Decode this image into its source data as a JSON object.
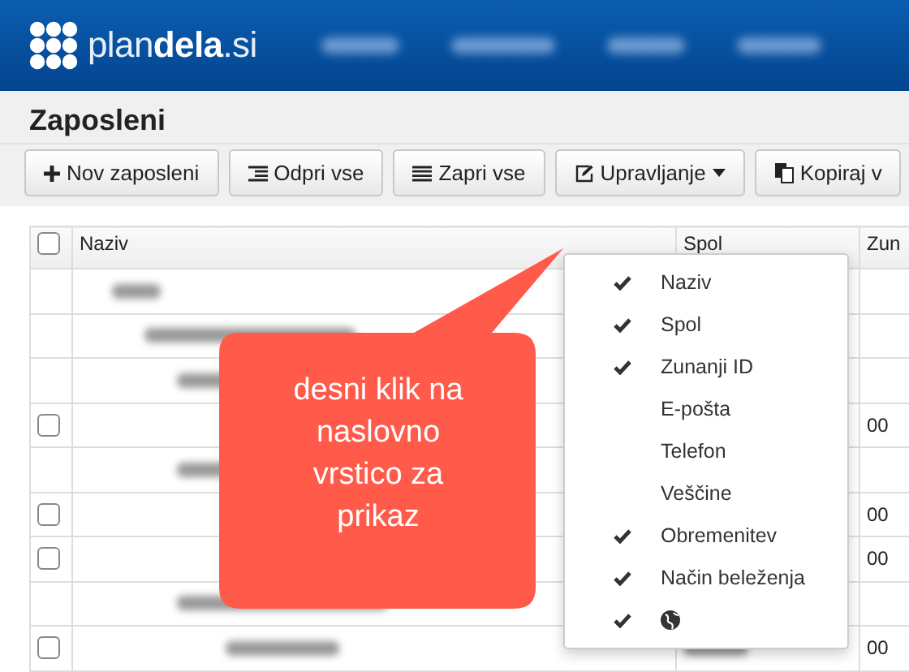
{
  "header": {
    "logo": "plan**dela**.si"
  },
  "page_title": "Zaposleni",
  "toolbar": [
    {
      "label": "Nov zaposleni"
    },
    {
      "label": "Odpri vse"
    },
    {
      "label": "Zapri vse"
    },
    {
      "label": "Upravljanje"
    },
    {
      "label": "Kopiraj v"
    }
  ],
  "table": {
    "select_all": {
      "checked": false
    },
    "columns": [
      "Naziv",
      "Spol",
      "Zun"
    ],
    "rows": [
      {
        "kind": "group"
      },
      {
        "kind": "group"
      },
      {
        "kind": "group"
      },
      {
        "kind": "item",
        "checked": false,
        "column_3": "00"
      },
      {
        "kind": "group"
      },
      {
        "kind": "item",
        "checked": false,
        "column_3": "00"
      },
      {
        "kind": "item",
        "checked": false,
        "column_3": "00"
      },
      {
        "kind": "group"
      },
      {
        "kind": "item",
        "checked": false,
        "column_3": "00"
      }
    ]
  },
  "callout": "desni klik na naslovno vrstico za prikaz",
  "column_menu": [
    {
      "kind": "text",
      "label": "Naziv",
      "checked": true
    },
    {
      "kind": "text",
      "label": "Spol",
      "checked": true
    },
    {
      "kind": "text",
      "label": "Zunanji ID",
      "checked": true
    },
    {
      "kind": "text",
      "label": "E-pošta",
      "checked": false
    },
    {
      "kind": "text",
      "label": "Telefon",
      "checked": false
    },
    {
      "kind": "text",
      "label": "Veščine",
      "checked": false
    },
    {
      "kind": "text",
      "label": "Obremenitev",
      "checked": true
    },
    {
      "kind": "text",
      "label": "Način beleženja",
      "checked": true
    },
    {
      "kind": "globe",
      "checked": true
    }
  ]
}
